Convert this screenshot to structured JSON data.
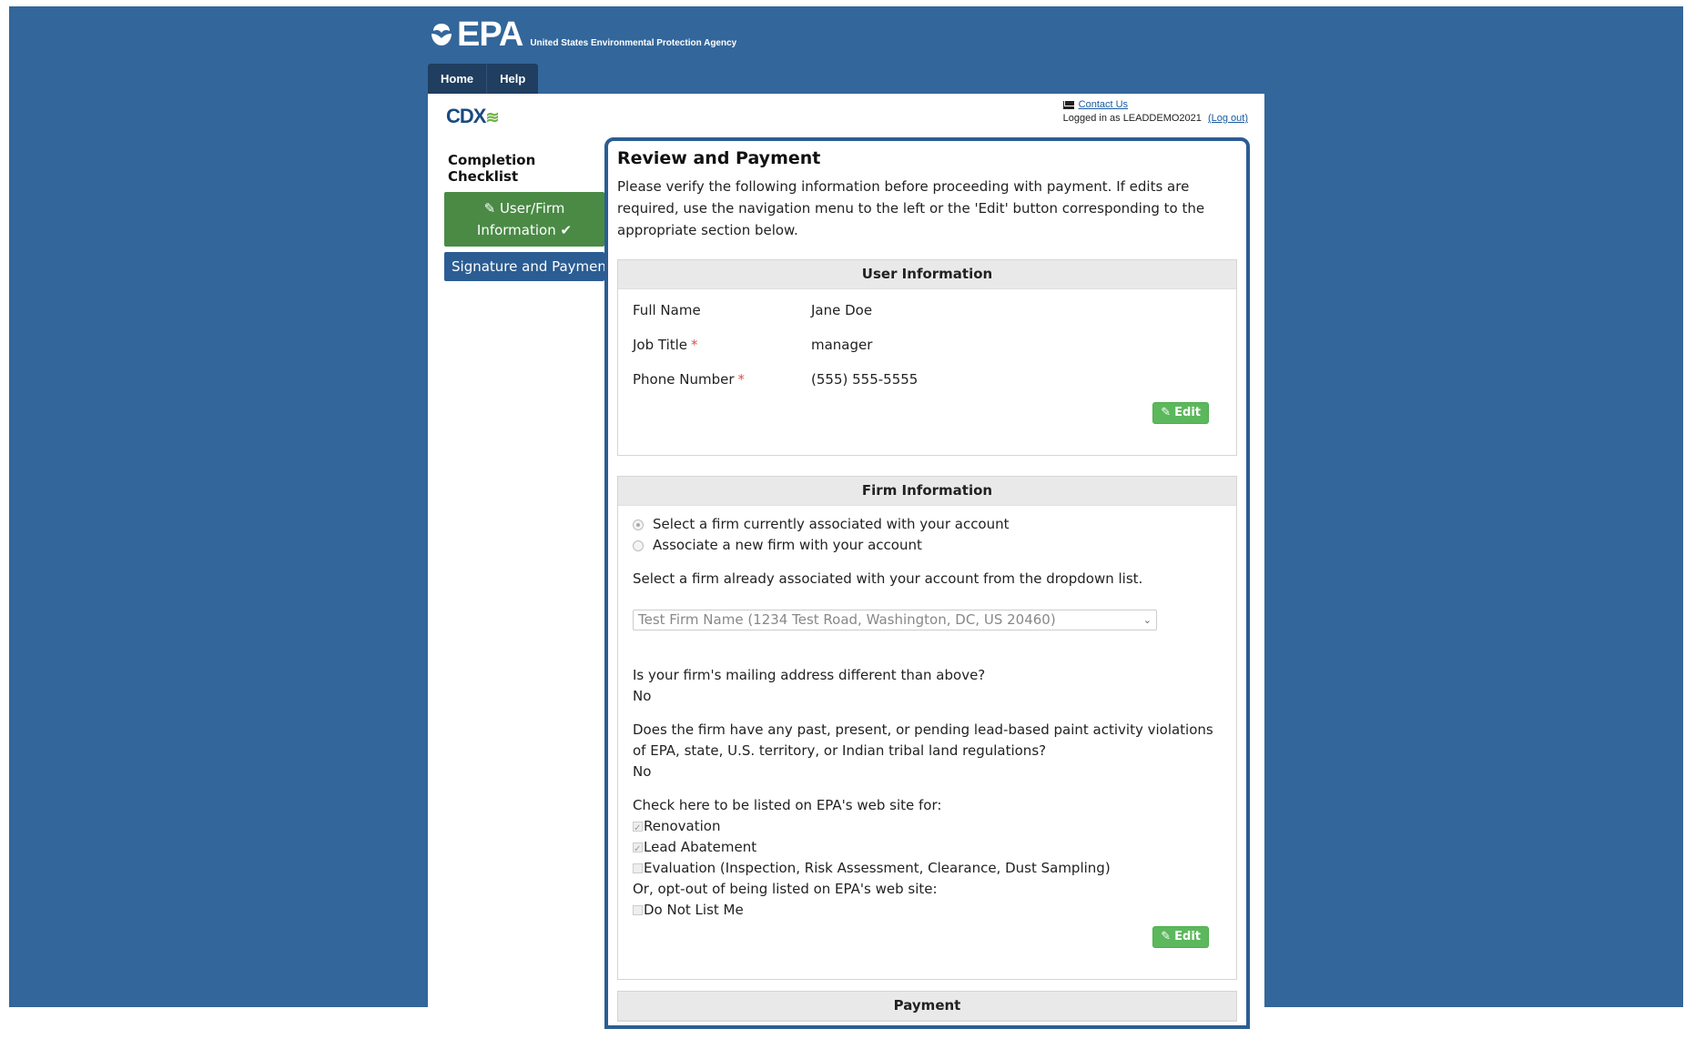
{
  "header": {
    "logo_text": "EPA",
    "agency_name": "United States Environmental Protection Agency"
  },
  "nav": {
    "home": "Home",
    "help": "Help"
  },
  "cdx_logo": "CDX",
  "contact": {
    "contact_link": "Contact Us",
    "logged_in_text": "Logged in as LEADDEMO2021",
    "logout_link": "(Log out)"
  },
  "sidebar": {
    "title": "Completion Checklist",
    "items": [
      {
        "label_line1": "User/Firm",
        "label_line2": "Information",
        "state": "complete"
      },
      {
        "label": "Signature and Payment",
        "state": "active"
      }
    ]
  },
  "main": {
    "title": "Review and Payment",
    "intro": "Please verify the following information before proceeding with payment. If edits are required, use the navigation menu to the left or the 'Edit' button corresponding to the appropriate section below.",
    "user_info": {
      "header": "User Information",
      "rows": [
        {
          "label": "Full Name",
          "value": "Jane Doe",
          "required": false
        },
        {
          "label": "Job Title",
          "value": "manager",
          "required": true
        },
        {
          "label": "Phone Number",
          "value": "(555) 555-5555",
          "required": true
        }
      ],
      "edit_label": "Edit"
    },
    "firm_info": {
      "header": "Firm Information",
      "radio_options": [
        {
          "label": "Select a firm currently associated with your account",
          "checked": true
        },
        {
          "label": "Associate a new firm with your account",
          "checked": false
        }
      ],
      "select_prompt": "Select a firm already associated with your account from the dropdown list.",
      "selected_firm": "Test Firm Name (1234 Test Road, Washington, DC, US 20460)",
      "mailing_question": "Is your firm's mailing address different than above?",
      "mailing_answer": "No",
      "violations_question": "Does the firm have any past, present, or pending lead-based paint activity violations of EPA, state, U.S. territory, or Indian tribal land regulations?",
      "violations_answer": "No",
      "listing_prompt": "Check here to be listed on EPA's web site for:",
      "listing_options": [
        {
          "label": "Renovation",
          "checked": true
        },
        {
          "label": "Lead Abatement",
          "checked": true
        },
        {
          "label": "Evaluation (Inspection, Risk Assessment, Clearance, Dust Sampling)",
          "checked": false
        }
      ],
      "optout_prompt": "Or, opt-out of being listed on EPA's web site:",
      "optout_option": {
        "label": "Do Not List Me",
        "checked": false
      },
      "edit_label": "Edit"
    },
    "payment": {
      "header": "Payment"
    }
  },
  "colors": {
    "background": "#33669a",
    "nav_dark": "#1f3e60",
    "complete_green": "#4a8a45",
    "active_blue": "#2b5d93",
    "edit_green": "#5cb85c",
    "required_red": "#d9534f"
  }
}
